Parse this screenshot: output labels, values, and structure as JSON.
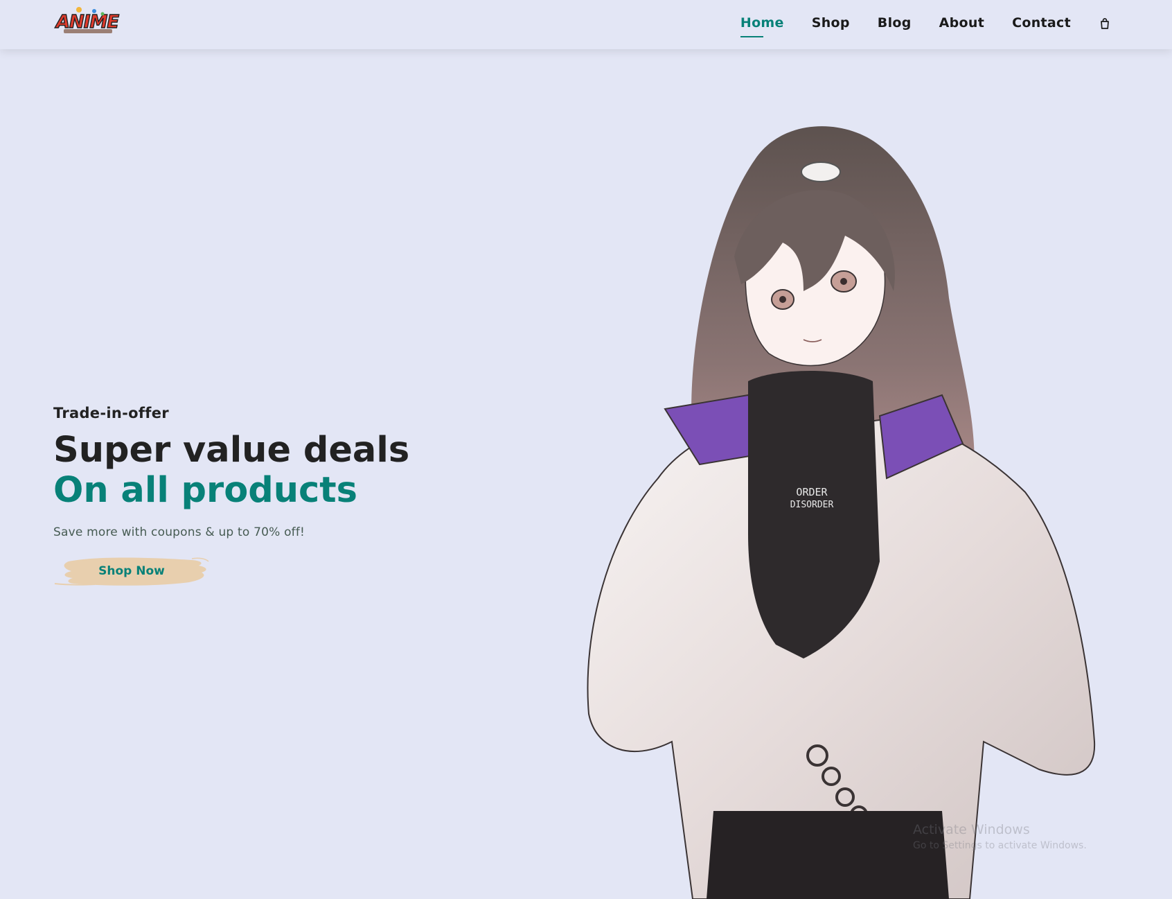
{
  "header": {
    "logo_text": "ANIME",
    "nav": [
      {
        "label": "Home",
        "active": true
      },
      {
        "label": "Shop",
        "active": false
      },
      {
        "label": "Blog",
        "active": false
      },
      {
        "label": "About",
        "active": false
      },
      {
        "label": "Contact",
        "active": false
      }
    ],
    "cart_icon": "shopping-bag-icon"
  },
  "hero": {
    "tag": "Trade-in-offer",
    "title": "Super value deals",
    "subtitle": "On all products",
    "description": "Save more with coupons & up to 70% off!",
    "cta": "Shop Now",
    "shirt_text_1": "ORDER",
    "shirt_text_2": "DISORDER"
  },
  "watermark": {
    "line1": "Activate Windows",
    "line2": "Go to Settings to activate Windows."
  },
  "colors": {
    "accent": "#088178",
    "background": "#e3e6f5",
    "button_brush": "#e8cfae",
    "text": "#1a1a1a"
  }
}
